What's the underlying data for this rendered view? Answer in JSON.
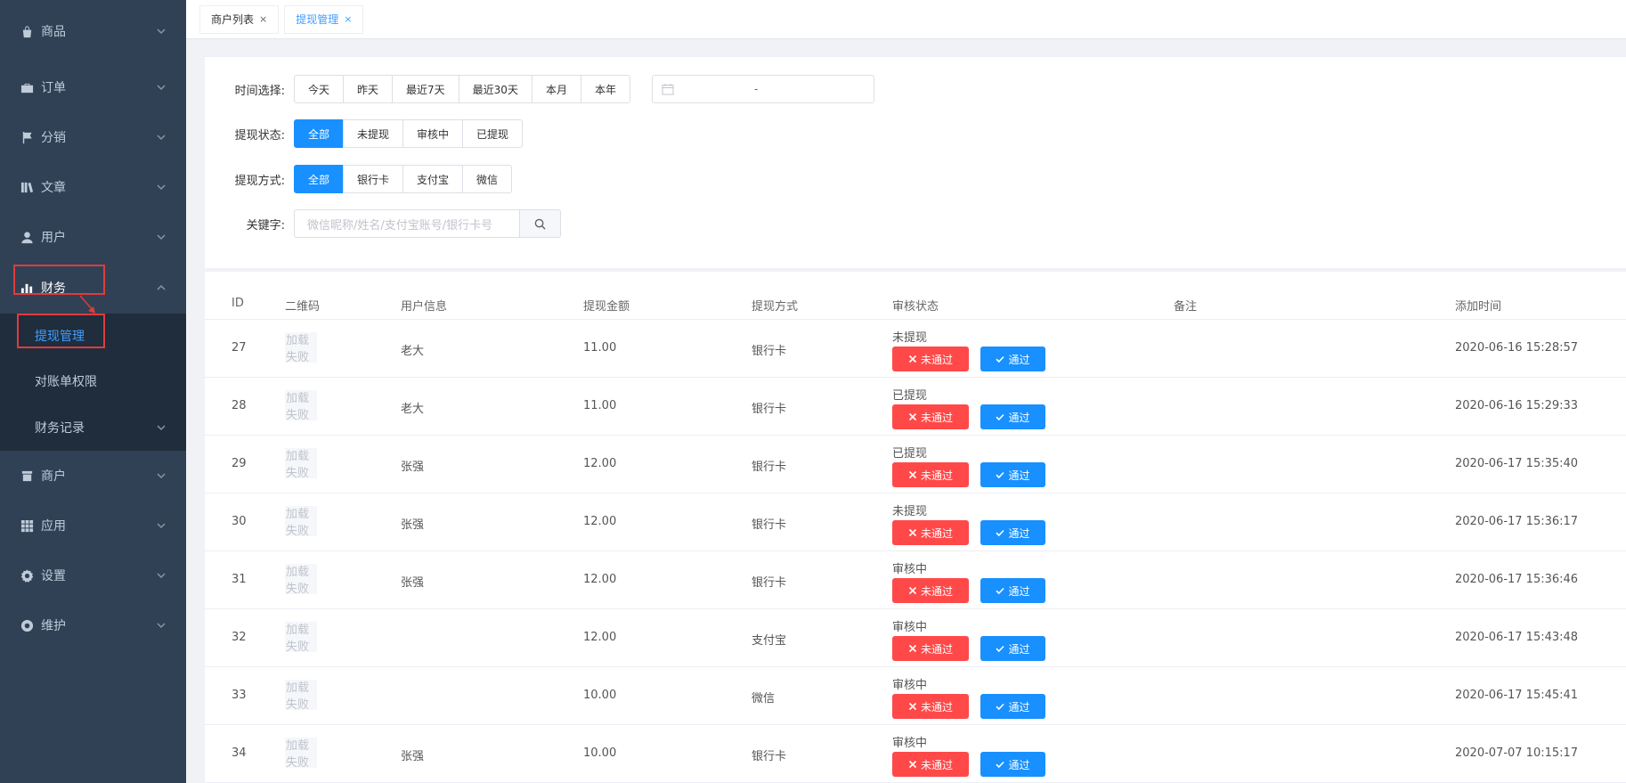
{
  "sidebar": {
    "items": [
      {
        "label": "商品",
        "icon": "bag-icon"
      },
      {
        "label": "订单",
        "icon": "briefcase-icon"
      },
      {
        "label": "分销",
        "icon": "flag-icon"
      },
      {
        "label": "文章",
        "icon": "books-icon"
      },
      {
        "label": "用户",
        "icon": "user-icon"
      },
      {
        "label": "财务",
        "icon": "bar-chart-icon"
      },
      {
        "label": "商户",
        "icon": "shop-icon"
      },
      {
        "label": "应用",
        "icon": "grid-icon"
      },
      {
        "label": "设置",
        "icon": "gear-icon"
      },
      {
        "label": "维护",
        "icon": "maintenance-icon"
      }
    ],
    "finance_sub": [
      {
        "label": "提现管理"
      },
      {
        "label": "对账单权限"
      },
      {
        "label": "财务记录"
      }
    ]
  },
  "tabs": [
    {
      "label": "商户列表",
      "close": "×"
    },
    {
      "label": "提现管理",
      "close": "×"
    }
  ],
  "filters": {
    "time_label": "时间选择:",
    "time_options": [
      "今天",
      "昨天",
      "最近7天",
      "最近30天",
      "本月",
      "本年"
    ],
    "date_sep": "-",
    "status_label": "提现状态:",
    "status_options": [
      "全部",
      "未提现",
      "审核中",
      "已提现"
    ],
    "method_label": "提现方式:",
    "method_options": [
      "全部",
      "银行卡",
      "支付宝",
      "微信"
    ],
    "keyword_label": "关键字:",
    "keyword_placeholder": "微信昵称/姓名/支付宝账号/银行卡号"
  },
  "table": {
    "headers": [
      "ID",
      "二维码",
      "用户信息",
      "提现金额",
      "提现方式",
      "审核状态",
      "备注",
      "添加时间"
    ],
    "qr_placeholder": "加载 失败",
    "reject_label": "未通过",
    "pass_label": "通过",
    "rows": [
      {
        "id": "27",
        "user": "老大",
        "amount": "11.00",
        "method": "银行卡",
        "status": "未提现",
        "note": "",
        "time": "2020-06-16 15:28:57"
      },
      {
        "id": "28",
        "user": "老大",
        "amount": "11.00",
        "method": "银行卡",
        "status": "已提现",
        "note": "",
        "time": "2020-06-16 15:29:33"
      },
      {
        "id": "29",
        "user": "张强",
        "amount": "12.00",
        "method": "银行卡",
        "status": "已提现",
        "note": "",
        "time": "2020-06-17 15:35:40"
      },
      {
        "id": "30",
        "user": "张强",
        "amount": "12.00",
        "method": "银行卡",
        "status": "未提现",
        "note": "",
        "time": "2020-06-17 15:36:17"
      },
      {
        "id": "31",
        "user": "张强",
        "amount": "12.00",
        "method": "银行卡",
        "status": "审核中",
        "note": "",
        "time": "2020-06-17 15:36:46"
      },
      {
        "id": "32",
        "user": "",
        "amount": "12.00",
        "method": "支付宝",
        "status": "审核中",
        "note": "",
        "time": "2020-06-17 15:43:48"
      },
      {
        "id": "33",
        "user": "",
        "amount": "10.00",
        "method": "微信",
        "status": "审核中",
        "note": "",
        "time": "2020-06-17 15:45:41"
      },
      {
        "id": "34",
        "user": "张强",
        "amount": "10.00",
        "method": "银行卡",
        "status": "审核中",
        "note": "",
        "time": "2020-07-07 10:15:17"
      }
    ]
  },
  "colors": {
    "sidebar_bg": "#304156",
    "submenu_bg": "#1f2d3d",
    "primary": "#1890ff",
    "danger": "#ff4949",
    "highlight": "#e03b3b"
  }
}
